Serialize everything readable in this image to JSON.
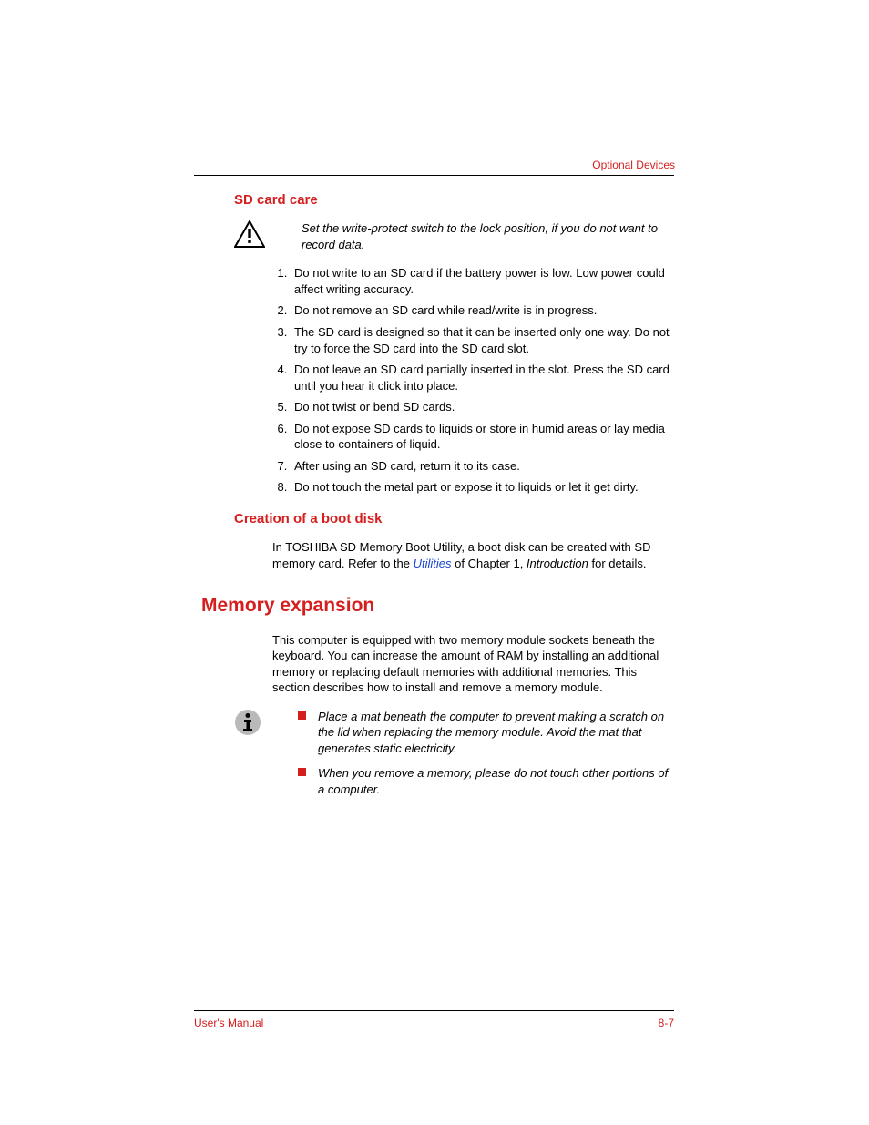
{
  "header": {
    "section_label": "Optional Devices"
  },
  "sd_card_care": {
    "heading": "SD card care",
    "caution": "Set the write-protect switch to the lock position, if you do not want to record data.",
    "items": [
      "Do not write to an SD card if the battery power is low. Low power could affect writing accuracy.",
      "Do not remove an SD card while read/write is in progress.",
      "The SD card is designed so that it can be inserted only one way. Do not try to force the SD card into the SD card slot.",
      "Do not leave an SD card partially inserted in the slot. Press the SD card until you hear it click into place.",
      "Do not twist or bend SD cards.",
      "Do not expose SD cards to liquids or store in humid areas or lay media close to containers of liquid.",
      "After using an SD card, return it to its case.",
      "Do not touch the metal part or expose it to liquids or let it get dirty."
    ]
  },
  "boot_disk": {
    "heading": "Creation of a boot disk",
    "text_pre": "In TOSHIBA SD Memory Boot Utility, a boot disk can be created with SD memory card. Refer to the ",
    "link": "Utilities",
    "text_mid": " of Chapter 1, ",
    "chapter": "Introduction",
    "text_post": " for details."
  },
  "memory_expansion": {
    "heading": "Memory expansion",
    "intro": "This computer is equipped with two memory module sockets beneath the keyboard. You can increase the amount of RAM by installing an additional memory or replacing default memories with additional memories. This section describes how to install and remove a memory module.",
    "notes": [
      "Place a mat beneath the computer to prevent making a scratch on the lid when replacing the memory module. Avoid the mat that generates static electricity.",
      "When you remove a memory, please do not touch other portions of a computer."
    ]
  },
  "footer": {
    "left": "User's Manual",
    "right": "8-7"
  }
}
